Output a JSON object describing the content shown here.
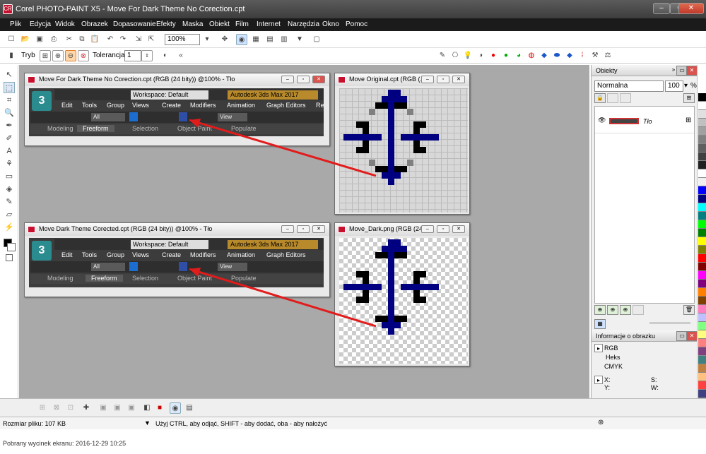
{
  "window": {
    "title": "Corel PHOTO-PAINT X5 - Move For Dark Theme No Corection.cpt",
    "app_icon_label": "CR"
  },
  "menu": [
    "Plik",
    "Edycja",
    "Widok",
    "Obrazek",
    "Dopasowanie",
    "Efekty",
    "Maska",
    "Obiekt",
    "Film",
    "Internet",
    "Narzędzia",
    "Okno",
    "Pomoc"
  ],
  "toolbar": {
    "zoom_value": "100%"
  },
  "property_bar": {
    "mode_label": "Tryb",
    "tolerance_label": "Tolerancja",
    "tolerance_value": "1"
  },
  "documents": [
    {
      "title": "Move For Dark Theme No Corection.cpt (RGB (24 bity)) @100% - Tło"
    },
    {
      "title": "Move Original.cpt (RGB (..."
    },
    {
      "title": "Move Dark Theme Corected.cpt (RGB (24 bity)) @100% - Tło"
    },
    {
      "title": "Move_Dark.png (RGB (24..."
    }
  ],
  "max_ui": {
    "logo": "3",
    "workspace": "Workspace: Default",
    "brand": "Autodesk 3ds Max 2017",
    "menu": [
      "Edit",
      "Tools",
      "Group",
      "Views",
      "Create",
      "Modifiers",
      "Animation",
      "Graph Editors",
      "Rende"
    ],
    "selection_filter": "All",
    "view_label": "View",
    "ribbon_tabs": [
      "Modeling",
      "Freeform",
      "Selection",
      "Object Paint",
      "Populate"
    ]
  },
  "docker": {
    "objects_title": "Obiekty",
    "blend_mode": "Normalna",
    "opacity": "100",
    "layer_name": "Tło",
    "info_title": "Informacje o obrazku",
    "info_rows": [
      "RGB",
      "Heks",
      "CMYK"
    ],
    "coords": {
      "x_label": "X:",
      "y_label": "Y:",
      "s_label": "S:",
      "w_label": "W:"
    }
  },
  "palette_colors": [
    "#000000",
    "#ffffff",
    "#e0e0e0",
    "#c0c0c0",
    "#a0a0a0",
    "#808080",
    "#606060",
    "#404040",
    "#202020",
    "#ffffff",
    "#f0f0f0",
    "#0000ff",
    "#000080",
    "#00ffff",
    "#008080",
    "#00ff00",
    "#008000",
    "#ffff00",
    "#808000",
    "#ff0000",
    "#800000",
    "#ff00ff",
    "#800080",
    "#ff8000",
    "#804000",
    "#ff80c0",
    "#c0c0ff",
    "#80ff80",
    "#ffff80",
    "#ff8080",
    "#804080",
    "#408080",
    "#c08040",
    "#ffc080",
    "#ff4040",
    "#404080"
  ],
  "status": {
    "file_size": "Rozmiar pliku: 107 KB",
    "hint": "Użyj CTRL, aby odjąć, SHIFT - aby dodać, oba - aby nałożyć"
  },
  "caption": "Pobrany wycinek ekranu: 2016-12-29 10:25"
}
